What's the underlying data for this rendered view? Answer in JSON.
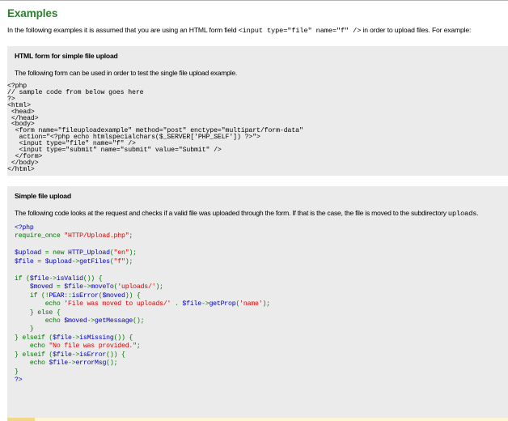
{
  "page": {
    "title": "Examples",
    "intro_before": "In the following examples it is assumed that you are using an HTML form field ",
    "intro_code": "<input type=\"file\" name=\"f\" />",
    "intro_after": " in order to upload files. For example:"
  },
  "section1": {
    "heading": "HTML form for simple file upload",
    "description": "The following form can be used in order to test the single file upload example.",
    "code": "<?php\n// sample code from below goes here\n?>\n<html>\n <head>\n </head>\n <body>\n  <form name=\"fileuploadexample\" method=\"post\" enctype=\"multipart/form-data\"\n   action=\"<?php echo htmlspecialchars($_SERVER['PHP_SELF']) ?>\">\n   <input type=\"file\" name=\"f\" />\n   <input type=\"submit\" name=\"submit\" value=\"Submit\" />\n  </form>\n </body>\n</html>"
  },
  "section2": {
    "heading": "Simple file upload",
    "description_before": "The following code looks at the request and checks if a valid file was uploaded through the form. If that is the case, the file is moved to the subdirectory ",
    "description_code": "uploads",
    "description_after": "."
  },
  "colors": {
    "title": "#2e7d32",
    "box_background": "#ebebeb",
    "php_default": "#0000bb",
    "php_keyword": "#007700",
    "php_string": "#dd0000"
  }
}
